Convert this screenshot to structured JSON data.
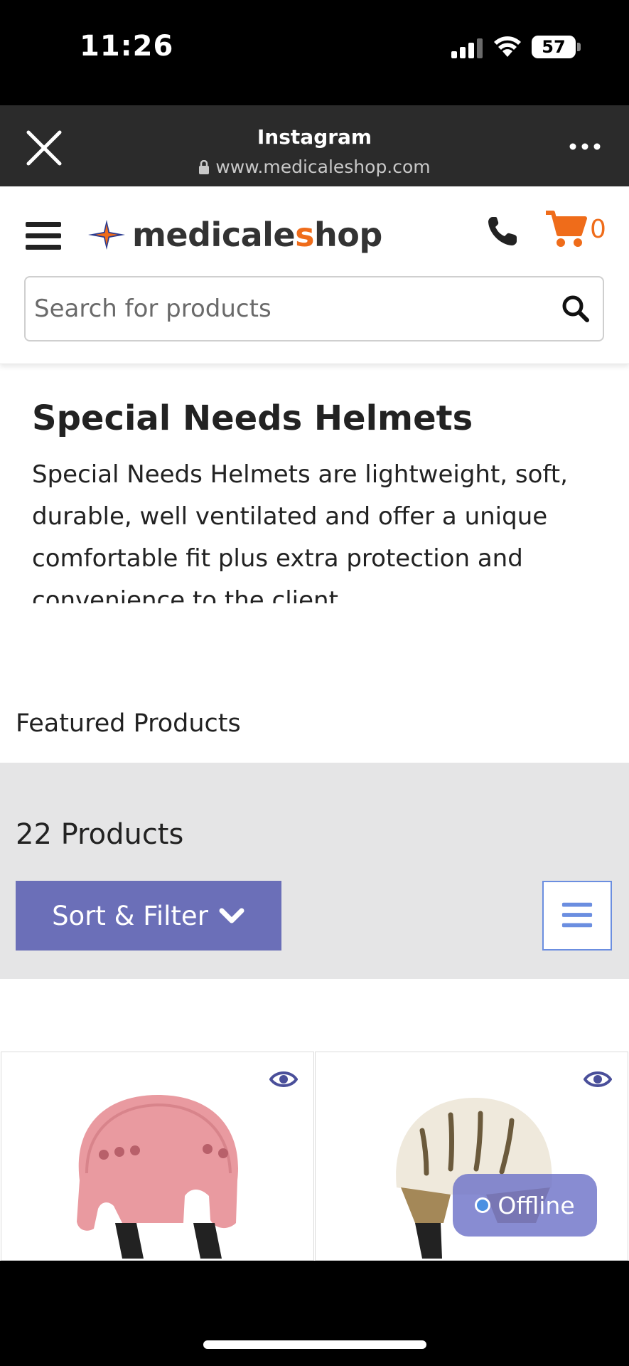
{
  "status_bar": {
    "time": "11:26",
    "battery": "57"
  },
  "browser": {
    "title": "Instagram",
    "url": "www.medicaleshop.com"
  },
  "header": {
    "logo_part1": "medicale",
    "logo_part2": "s",
    "logo_part3": "hop",
    "cart_count": "0",
    "search_placeholder": "Search for products"
  },
  "category": {
    "title": "Special Needs Helmets",
    "description": "Special Needs Helmets are lightweight, soft, durable, well ventilated and offer a unique comfortable fit plus extra protection and convenience to the client."
  },
  "featured_label": "Featured Products",
  "toolbar": {
    "product_count": "22 Products",
    "sort_filter_label": "Sort & Filter"
  },
  "products": [
    {
      "color": "#e99aa0"
    },
    {
      "color": "#efe9dc"
    }
  ],
  "chat": {
    "status": "Offline"
  },
  "colors": {
    "accent": "#ef6c1a",
    "button": "#6b6fb8",
    "toolbar_bg": "#e5e5e6"
  }
}
